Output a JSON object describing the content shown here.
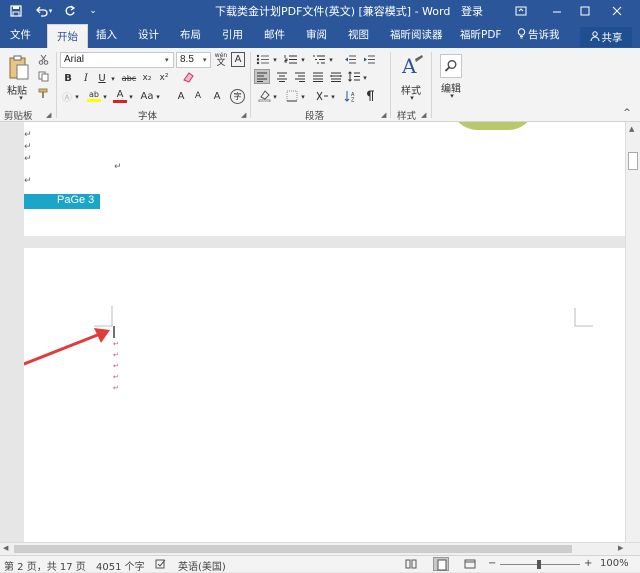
{
  "titlebar": {
    "save_icon": "save-icon",
    "undo_icon": "undo-icon",
    "redo_icon": "redo-icon",
    "title": "下载类金计划PDF文件(英文) [兼容模式] - Word",
    "login": "登录"
  },
  "tabs": [
    {
      "label": "文件"
    },
    {
      "label": "开始"
    },
    {
      "label": "插入"
    },
    {
      "label": "设计"
    },
    {
      "label": "布局"
    },
    {
      "label": "引用"
    },
    {
      "label": "邮件"
    },
    {
      "label": "审阅"
    },
    {
      "label": "视图"
    },
    {
      "label": "福昕阅读器"
    },
    {
      "label": "福昕PDF"
    }
  ],
  "tell_me": "告诉我",
  "share": "共享",
  "ribbon": {
    "paste_label": "粘贴",
    "font_name": "Arial",
    "font_size": "8.5",
    "wen": "wén",
    "wen_char": "文",
    "A_box": "A",
    "bold": "B",
    "italic": "I",
    "underline": "U",
    "strike": "abc",
    "sub": "x₂",
    "sup": "x²",
    "clear": "A",
    "highlight": "ab",
    "fontcolor": "A",
    "case": "Aa",
    "grow": "A",
    "shrink": "A",
    "phon": "A",
    "encl": "字",
    "style_label": "样式",
    "edit_label": "编辑",
    "group_clipboard": "剪贴板",
    "group_font": "字体",
    "group_paragraph": "段落",
    "group_styles": "样式"
  },
  "document": {
    "para_marks": [
      "↵",
      "↵",
      "↵",
      "↵",
      "↵"
    ],
    "footer_text": "PaGe 3"
  },
  "status": {
    "page": "第 2 页，共 17 页",
    "words": "4051 个字",
    "lang": "英语(美国)",
    "zoom": "100%"
  },
  "colors": {
    "brand": "#2b579a",
    "footer_band": "#1ba5c8",
    "arrow": "#e03c3c",
    "circle": "#b8c86a"
  }
}
